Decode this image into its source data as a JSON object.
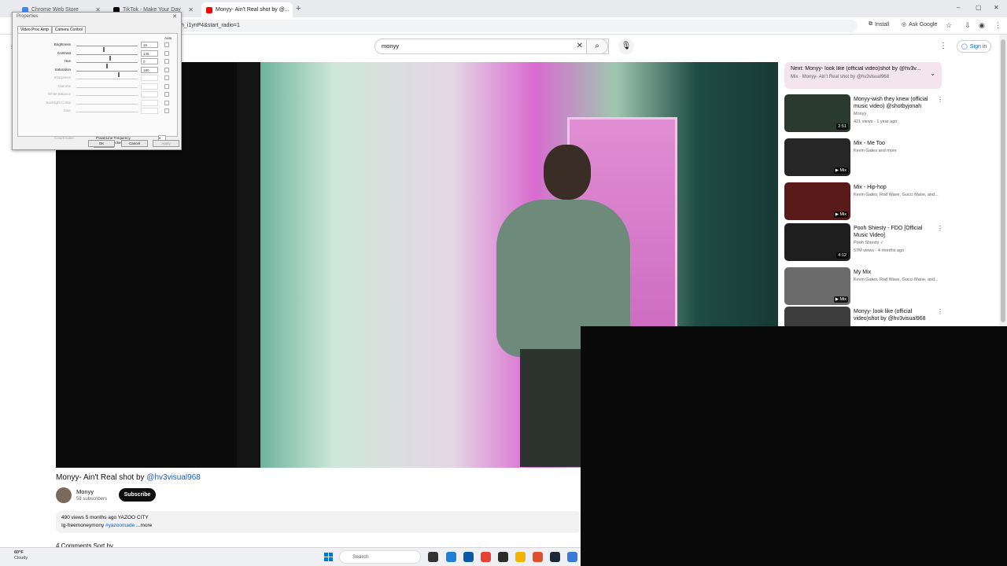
{
  "browser": {
    "tabs": [
      {
        "label": "Chrome Web Store",
        "color": "#4285f4",
        "active": false
      },
      {
        "label": "TikTok - Make Your Day",
        "color": "#000000",
        "active": false
      },
      {
        "label": "Monyy- Ain't Real shot by @...",
        "color": "#ff0000",
        "active": true
      }
    ],
    "new_tab": "+",
    "url": "h_i1ynP4&start_radio=1",
    "install_label": "Install",
    "ask_google_label": "Ask Google",
    "window_controls": [
      "–",
      "▢",
      "✕"
    ]
  },
  "youtube": {
    "search_value": "monyy",
    "sign_in": "Sign in",
    "video_title": "Monyy- Ain't Real shot by ",
    "video_title_tag": "@hv3visual968",
    "channel": {
      "name": "Monyy",
      "subs": "58 subscribers"
    },
    "subscribe": "Subscribe",
    "description": {
      "meta": "490 views  5 months ago  YAZOO CITY",
      "text": "Ig-freemoneymony ",
      "tag": "#yazoomade",
      "more": " ...more"
    },
    "comments_cut": "4 Comments     Sort by",
    "up_next": {
      "line1": "Next: Monyy- look like (official video)shot by @hv3v...",
      "line2": "Mix · Monyy- Ain't Real shot by @hv3visual968"
    },
    "recommendations": [
      {
        "title": "Monyy-wish they knew (official music video) @shotbyjonah",
        "sub1": "Monyy",
        "sub2": "421 views · 1 year ago",
        "badge": "2:51",
        "thumb": "#2b3a2e"
      },
      {
        "title": "Mix - Me Too",
        "sub1": "Kevin Gates and more",
        "sub2": "",
        "badge": "▶ Mix",
        "thumb": "#262626"
      },
      {
        "title": "Mix - Hip-hop",
        "sub1": "Kevin Gates, Rod Wave, Gucci Mane, and...",
        "sub2": "",
        "badge": "▶ Mix",
        "thumb": "#5a1a1a"
      },
      {
        "title": "Pooh Shiesty - FDO [Official Music Video]",
        "sub1": "Pooh Shiesty ✓",
        "sub2": "57M views · 4 months ago",
        "badge": "4:12",
        "thumb": "#1e1e1e"
      },
      {
        "title": "My Mix",
        "sub1": "Kevin Gates, Rod Wave, Gucci Mane, and...",
        "sub2": "",
        "badge": "▶ Mix",
        "thumb": "#6b6b6b"
      },
      {
        "title": "Monyy- look like (official video)shot by @hv3visual968",
        "sub1": "",
        "sub2": "",
        "badge": "",
        "thumb": "#3d3d3d"
      }
    ]
  },
  "dialog": {
    "title": "Properties",
    "tabs": [
      "Video Proc Amp",
      "Camera Control"
    ],
    "auto_label": "Auto",
    "rows": [
      {
        "label": "Brightness",
        "value": "15",
        "knob": 0.45,
        "enabled": true
      },
      {
        "label": "Contrast",
        "value": "145",
        "knob": 0.55,
        "enabled": true
      },
      {
        "label": "Hue",
        "value": "0",
        "knob": 0.5,
        "enabled": true
      },
      {
        "label": "Saturation",
        "value": "180",
        "knob": 0.7,
        "enabled": true
      },
      {
        "label": "Sharpness",
        "value": "",
        "knob": 0.0,
        "enabled": false
      },
      {
        "label": "Gamma",
        "value": "",
        "knob": 0.0,
        "enabled": false
      },
      {
        "label": "White Balance",
        "value": "",
        "knob": 0.0,
        "enabled": false
      },
      {
        "label": "Backlight Comp",
        "value": "",
        "knob": 0.0,
        "enabled": false
      },
      {
        "label": "Gain",
        "value": "",
        "knob": 0.0,
        "enabled": false
      }
    ],
    "color_enable": "ColorEnable",
    "powerline": "PowerLine Frequency\n(Anti Flicker)",
    "default_btn": "Default",
    "ok": "OK",
    "cancel": "Cancel",
    "apply": "Apply"
  },
  "taskbar": {
    "temp": "60°F",
    "weather": "Cloudy",
    "search": "Search"
  }
}
